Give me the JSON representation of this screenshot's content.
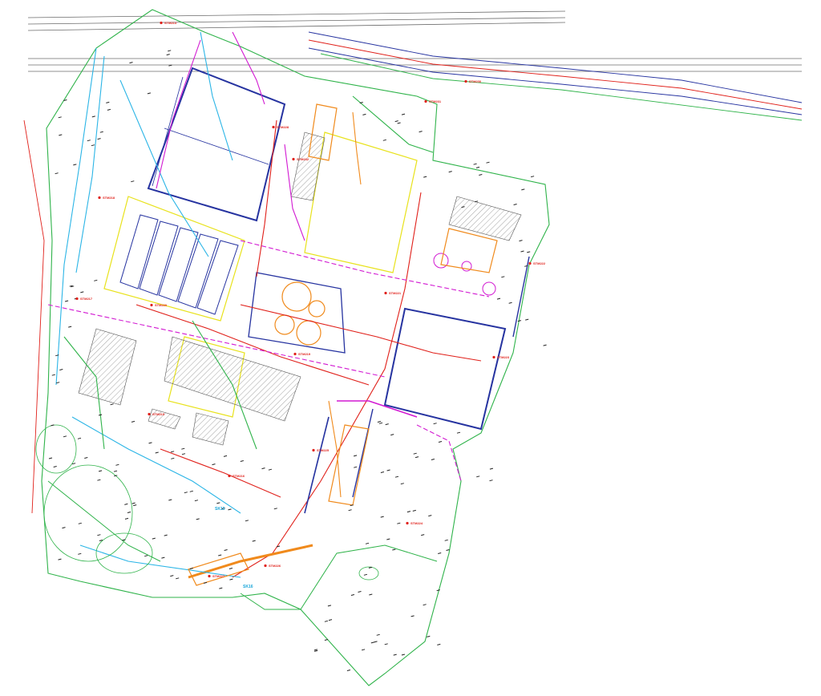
{
  "drawing": {
    "kind": "CAD utility site plan",
    "colors": {
      "background": "#ffffff",
      "boundary_green": "#2fb34a",
      "utility_red": "#e0201a",
      "utility_blue": "#1c39c9",
      "utility_cyan": "#2bb5e6",
      "utility_magenta": "#d21ad2",
      "utility_orange": "#f08a1c",
      "utility_yellow": "#e8e21c",
      "building_outline": "#2633a0",
      "railway_gray": "#6b6b6b",
      "text_marks": "#222222"
    },
    "point_labels": [
      {
        "id": "p1",
        "text": "STM214"
      },
      {
        "id": "p2",
        "text": "STM230"
      },
      {
        "id": "p3",
        "text": "STM231"
      },
      {
        "id": "p4",
        "text": "STM232"
      },
      {
        "id": "p5",
        "text": "STM218"
      },
      {
        "id": "p6",
        "text": "STM222"
      },
      {
        "id": "p7",
        "text": "STM223"
      },
      {
        "id": "p8",
        "text": "STM221"
      },
      {
        "id": "p9",
        "text": "STM219"
      },
      {
        "id": "p10",
        "text": "STM220"
      },
      {
        "id": "p11",
        "text": "STM217"
      },
      {
        "id": "p12",
        "text": "STM215"
      },
      {
        "id": "p13",
        "text": "STM216"
      },
      {
        "id": "p14",
        "text": "STM224"
      },
      {
        "id": "p15",
        "text": "STM225"
      },
      {
        "id": "p16",
        "text": "STM226"
      },
      {
        "id": "p17",
        "text": "STM227"
      },
      {
        "id": "p18",
        "text": "STM228"
      }
    ],
    "cyan_labels": [
      {
        "id": "c1",
        "text": "SK15"
      },
      {
        "id": "c2",
        "text": "SK16"
      }
    ]
  }
}
